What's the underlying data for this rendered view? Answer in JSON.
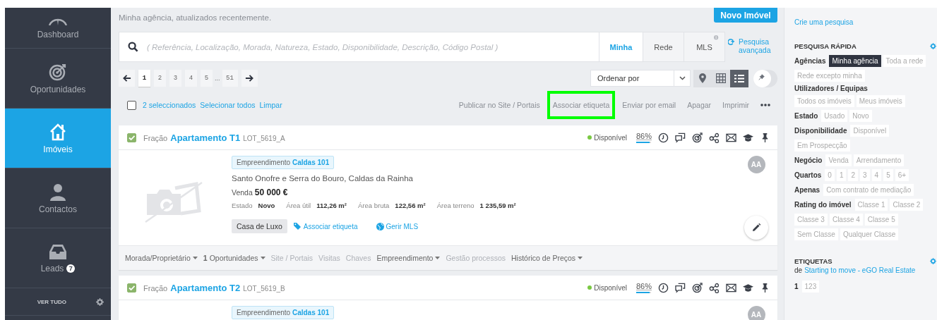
{
  "sidebar": {
    "items": [
      {
        "label": "Dashboard",
        "selected": false
      },
      {
        "label": "Oportunidades",
        "selected": false
      },
      {
        "label": "Imóveis",
        "selected": true
      },
      {
        "label": "Contactos",
        "selected": false
      },
      {
        "label": "Leads",
        "badge": "7",
        "selected": false
      }
    ],
    "footer": {
      "label": "VER TUDO"
    }
  },
  "header": {
    "subtitle": "Minha agência, atualizados recentemente.",
    "new_button": "Novo Imóvel"
  },
  "search": {
    "placeholder": "( Referência, Localização, Morada, Natureza, Estado, Disponibilidade, Descrição, Código Postal )",
    "scopes": [
      {
        "label": "Minha",
        "selected": true
      },
      {
        "label": "Rede",
        "selected": false
      },
      {
        "label": "MLS",
        "selected": false,
        "info": true
      }
    ],
    "advanced_link": "Pesquisa avançada"
  },
  "pagination": {
    "pages": [
      {
        "label": "1",
        "kind": "page",
        "selected": true
      },
      {
        "label": "2",
        "kind": "page",
        "selected": false
      },
      {
        "label": "3",
        "kind": "page",
        "selected": false
      },
      {
        "label": "4",
        "kind": "page",
        "selected": false
      },
      {
        "label": "5",
        "kind": "page",
        "selected": false
      },
      {
        "label": "...",
        "kind": "gap"
      },
      {
        "label": "51",
        "kind": "page",
        "selected": false
      }
    ]
  },
  "sort": {
    "label": "Ordenar por"
  },
  "views": [
    {
      "kind": "map",
      "selected": false
    },
    {
      "kind": "grid",
      "selected": false
    },
    {
      "kind": "list",
      "selected": true
    }
  ],
  "pin_toggle": {
    "on": false
  },
  "bulk": {
    "checked": false,
    "links": [
      "2 seleccionados",
      "Selecionar todos",
      "Limpar"
    ],
    "actions": [
      {
        "label": "Publicar no Site / Portais",
        "highlighted": false
      },
      {
        "label": "Associar etiqueta",
        "highlighted": true
      },
      {
        "label": "Enviar por email",
        "highlighted": false
      },
      {
        "label": "Apagar",
        "highlighted": false
      },
      {
        "label": "Imprimir",
        "highlighted": false
      }
    ]
  },
  "listings": [
    {
      "checked": true,
      "type": "Fração",
      "title": "Apartamento T1",
      "reference": "LOT_5619_A",
      "status": {
        "label": "Disponível",
        "color": "#7ac943"
      },
      "completeness": {
        "label": "86%",
        "level": 0.86
      },
      "avatar": "AA",
      "development": {
        "label": "Empreendimento",
        "name": "Caldas 101"
      },
      "location": "Santo Onofre e Serra do Bouro, Caldas da Rainha",
      "deal": "Venda",
      "price": "50 000 €",
      "attributes": [
        {
          "label": "Estado",
          "value": "Novo"
        },
        {
          "label": "Área útil",
          "value": "112,26 m²"
        },
        {
          "label": "Área bruta",
          "value": "122,56 m²"
        },
        {
          "label": "Área terreno",
          "value": "1 235,59 m²"
        }
      ],
      "tags": [
        "Casa de Luxo"
      ],
      "tag_link": "Associar etiqueta",
      "mls_link": "Gerir MLS",
      "footer_links": [
        {
          "label": "Morada/Proprietário",
          "dropdown": true,
          "disabled": false
        },
        {
          "label": "**1** Oportunidades",
          "dropdown": true,
          "disabled": false
        },
        {
          "label": "Site / Portais",
          "dropdown": false,
          "disabled": true
        },
        {
          "label": "Visitas",
          "dropdown": false,
          "disabled": true
        },
        {
          "label": "Chaves",
          "dropdown": false,
          "disabled": true
        },
        {
          "label": "Empreendimento",
          "dropdown": true,
          "disabled": false
        },
        {
          "label": "Gestão processos",
          "dropdown": false,
          "disabled": true
        },
        {
          "label": "Histórico de Preços",
          "dropdown": true,
          "disabled": false
        }
      ]
    },
    {
      "checked": true,
      "type": "Fração",
      "title": "Apartamento T2",
      "reference": "LOT_5619_B",
      "status": {
        "label": "Disponível",
        "color": "#7ac943"
      },
      "completeness": {
        "label": "86%",
        "level": 0.86
      },
      "avatar": "AA",
      "development": {
        "label": "Empreendimento",
        "name": "Caldas 101"
      }
    }
  ],
  "panel": {
    "custom_search_link": "Crie uma pesquisa",
    "quick_search": {
      "title": "PESQUISA RÁPIDA",
      "filters": [
        {
          "label": "Agências",
          "options": [
            {
              "label": "Minha agência",
              "selected": true
            },
            {
              "label": "Toda a rede",
              "selected": false
            },
            {
              "label": "Rede excepto minha",
              "selected": false
            }
          ]
        },
        {
          "label": "Utilizadores / Equipas",
          "options": [
            {
              "label": "Todos os imóveis",
              "selected": false
            },
            {
              "label": "Meus imóveis",
              "selected": false
            }
          ]
        },
        {
          "label": "Estado",
          "options": [
            {
              "label": "Usado",
              "selected": false
            },
            {
              "label": "Novo",
              "selected": false
            }
          ]
        },
        {
          "label": "Disponibilidade",
          "options": [
            {
              "label": "Disponível",
              "selected": false
            },
            {
              "label": "Em Prospecção",
              "selected": false
            }
          ]
        },
        {
          "label": "Negócio",
          "options": [
            {
              "label": "Venda",
              "selected": false
            },
            {
              "label": "Arrendamento",
              "selected": false
            }
          ]
        },
        {
          "label": "Quartos",
          "options": [
            {
              "label": "0",
              "selected": false
            },
            {
              "label": "1",
              "selected": false
            },
            {
              "label": "2",
              "selected": false
            },
            {
              "label": "3",
              "selected": false
            },
            {
              "label": "4",
              "selected": false
            },
            {
              "label": "5",
              "selected": false
            },
            {
              "label": "6+",
              "selected": false
            }
          ]
        },
        {
          "label": "Apenas",
          "options": [
            {
              "label": "Com contrato de mediação",
              "selected": false
            }
          ]
        },
        {
          "label": "Rating do imóvel",
          "options": [
            {
              "label": "Classe 1",
              "selected": false
            },
            {
              "label": "Classe 2",
              "selected": false
            },
            {
              "label": "Classe 3",
              "selected": false
            },
            {
              "label": "Classe 4",
              "selected": false
            },
            {
              "label": "Classe 5",
              "selected": false
            },
            {
              "label": "Sem Classe",
              "selected": false
            },
            {
              "label": "Qualquer Classe",
              "selected": false
            }
          ]
        }
      ]
    },
    "tags": {
      "title": "ETIQUETAS",
      "source_prefix": "de",
      "source": "Starting to move - eGO Real Estate",
      "pages": [
        {
          "label": "1",
          "selected": true
        },
        {
          "label": "123",
          "selected": false
        }
      ]
    }
  }
}
